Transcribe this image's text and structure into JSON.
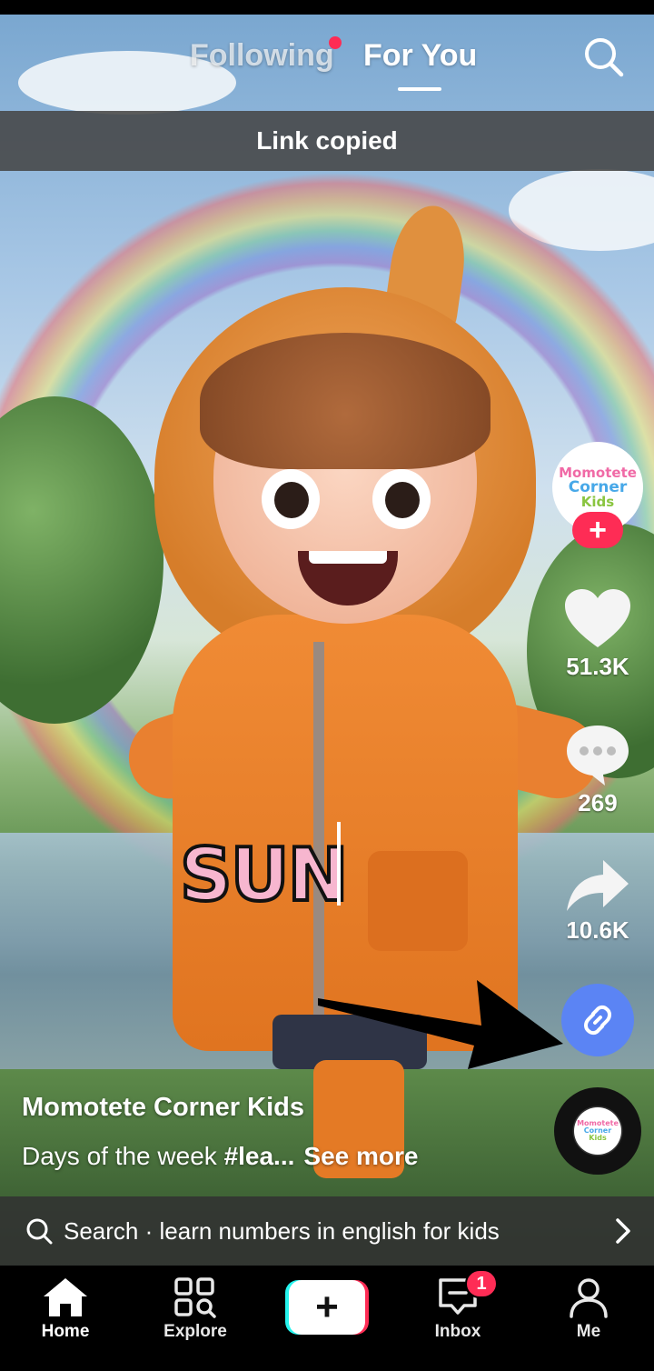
{
  "top_nav": {
    "following_label": "Following",
    "for_you_label": "For You",
    "search_icon": "search-icon"
  },
  "toast": {
    "text": "Link copied"
  },
  "video": {
    "overlay_word": "SUN"
  },
  "creator_avatar": {
    "line1": "Momotete",
    "line2": "Corner",
    "line3": "Kids",
    "follow_symbol": "+"
  },
  "actions": {
    "like_count": "51.3K",
    "comment_count": "269",
    "share_count": "10.6K",
    "link_icon": "link-icon"
  },
  "caption": {
    "author": "Momotete Corner Kids",
    "description_prefix": "Days of the week ",
    "description_tag": "#lea...",
    "see_more": "See more"
  },
  "search_suggestion": {
    "prefix": "Search · ",
    "query": "learn numbers in english for kids"
  },
  "bottom_nav": {
    "home": "Home",
    "explore": "Explore",
    "create_symbol": "+",
    "inbox": "Inbox",
    "inbox_badge": "1",
    "me": "Me"
  },
  "colors": {
    "accent_red": "#fe2c55",
    "accent_cyan": "#25f4ee",
    "link_button_blue": "#5b84f4"
  }
}
